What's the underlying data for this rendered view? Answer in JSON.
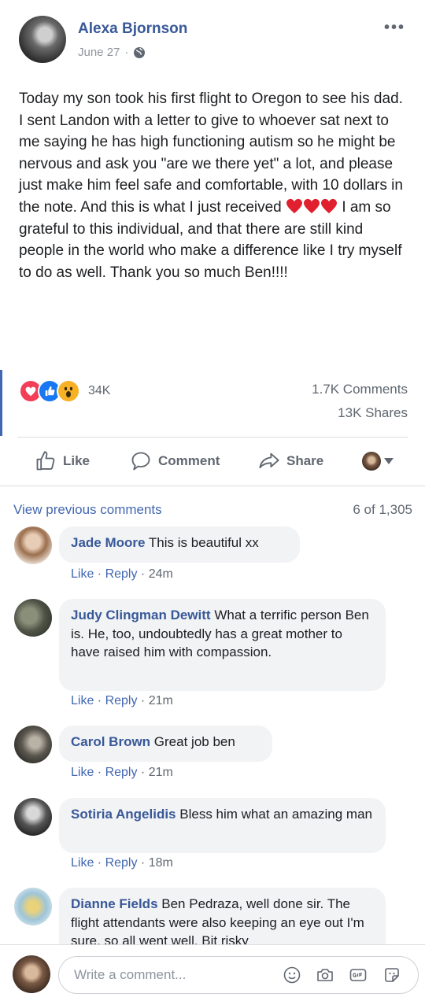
{
  "post": {
    "author": "Alexa Bjornson",
    "date": "June 27",
    "more": "•••",
    "text_before_hearts": "Today my son took his first flight to Oregon to see his dad. I sent Landon with a letter to give to whoever sat next to me saying he has high functioning autism so he might be nervous and ask you \"are we there yet\" a lot, and please just make him feel safe and comfortable, with 10 dollars in the note. And this is what I just received",
    "text_after_hearts": "I am so grateful to this individual, and that there are still kind people in the world who make a difference like I try myself to do as well. Thank you so much Ben!!!!"
  },
  "reactions": {
    "count": "34K",
    "comments": "1.7K Comments",
    "shares": "13K Shares"
  },
  "actions": {
    "like": "Like",
    "comment": "Comment",
    "share": "Share"
  },
  "comments_header": {
    "view_previous": "View previous comments",
    "count": "6 of 1,305"
  },
  "comments": [
    {
      "name": "Jade Moore",
      "text": "This is beautiful xx",
      "like": "Like",
      "reply": "Reply",
      "time": "24m"
    },
    {
      "name": "Judy Clingman Dewitt",
      "text": "What a terrific person Ben is. He, too, undoubtedly has a great mother to have raised him with compassion.",
      "like": "Like",
      "reply": "Reply",
      "time": "21m"
    },
    {
      "name": "Carol Brown",
      "text": "Great job ben",
      "like": "Like",
      "reply": "Reply",
      "time": "21m"
    },
    {
      "name": "Sotiria Angelidis",
      "text": "Bless him what an amazing man",
      "like": "Like",
      "reply": "Reply",
      "time": "18m"
    },
    {
      "name": "Dianne Fields",
      "text": "Ben Pedraza, well done sir. The flight attendants were also keeping an eye out I'm sure, so all went well. Bit risky",
      "like": "",
      "reply": "",
      "time": ""
    }
  ],
  "composer": {
    "placeholder": "Write a comment..."
  },
  "colors": {
    "brand": "#4267b2",
    "name": "#385898",
    "love": "#f33e58",
    "bubble": "#f2f3f5"
  }
}
